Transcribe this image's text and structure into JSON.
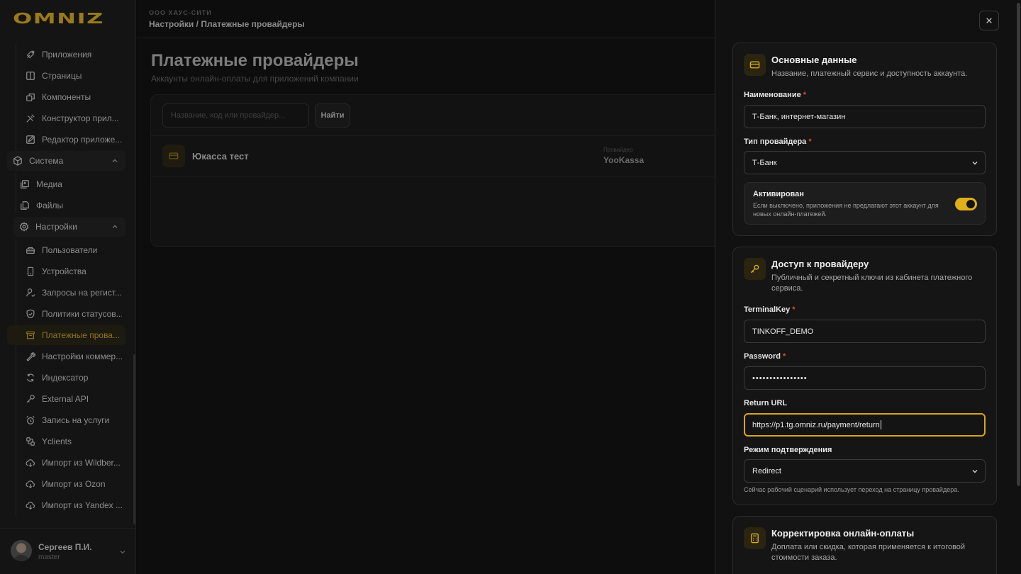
{
  "app": {
    "logo_text": "OMNIZ"
  },
  "sidebar": {
    "items": [
      {
        "label": "Приложения",
        "icon": "apps-icon"
      },
      {
        "label": "Страницы",
        "icon": "pages-icon"
      },
      {
        "label": "Компоненты",
        "icon": "components-icon"
      },
      {
        "label": "Конструктор прил...",
        "icon": "builder-icon"
      },
      {
        "label": "Редактор приложе...",
        "icon": "editor-icon"
      }
    ],
    "group_system": {
      "label": "Система",
      "icon": "system-icon"
    },
    "system_items": [
      {
        "label": "Медиа",
        "icon": "media-icon"
      },
      {
        "label": "Файлы",
        "icon": "files-icon"
      }
    ],
    "group_settings": {
      "label": "Настройки",
      "icon": "settings-icon"
    },
    "settings_items": [
      {
        "label": "Пользователи",
        "icon": "users-icon"
      },
      {
        "label": "Устройства",
        "icon": "device-icon"
      },
      {
        "label": "Запросы на регист...",
        "icon": "user-request-icon"
      },
      {
        "label": "Политики статусов...",
        "icon": "policy-icon"
      },
      {
        "label": "Платежные прова...",
        "icon": "payment-provider-icon",
        "active": true
      },
      {
        "label": "Настройки коммер...",
        "icon": "commerce-settings-icon"
      },
      {
        "label": "Индексатор",
        "icon": "refresh-icon"
      },
      {
        "label": "External API",
        "icon": "key-icon"
      },
      {
        "label": "Запись на услуги",
        "icon": "alarm-icon"
      },
      {
        "label": "Yclients",
        "icon": "yclients-icon"
      },
      {
        "label": "Импорт из Wildber...",
        "icon": "cloud-import-icon"
      },
      {
        "label": "Импорт из Ozon",
        "icon": "cloud-import-icon"
      },
      {
        "label": "Импорт из Yandex ...",
        "icon": "cloud-import-icon"
      }
    ],
    "user": {
      "name": "Сергеев П.И.",
      "role": "master"
    }
  },
  "main": {
    "company": "ООО ХАУС-СИТИ",
    "breadcrumb": "Настройки / Платежные провайдеры",
    "title": "Платежные провайдеры",
    "subtitle": "Аккаунты онлайн-оплаты для приложений компании",
    "search_placeholder": "Название, код или провайдер...",
    "find_label": "Найти",
    "rows": [
      {
        "name": "Юкасса тест",
        "provider_label": "Провайдер",
        "provider": "YooKassa"
      }
    ]
  },
  "drawer": {
    "basic": {
      "title": "Основные данные",
      "desc": "Название, платежный сервис и доступность аккаунта.",
      "name_label": "Наименование",
      "name_value": "Т-Банк, интернет-магазин",
      "type_label": "Тип провайдера",
      "type_value": "Т-Банк",
      "active_title": "Активирован",
      "active_desc": "Если выключено, приложения не предлагают этот аккаунт для новых онлайн-платежей.",
      "active_on": true
    },
    "access": {
      "title": "Доступ к провайдеру",
      "desc": "Публичный и секретный ключи из кабинета платежного сервиса.",
      "terminal_label": "TerminalKey",
      "terminal_value": "TINKOFF_DEMO",
      "password_label": "Password",
      "password_value": "••••••••••••••••",
      "return_label": "Return URL",
      "return_value": "https://p1.tg.omniz.ru/payment/return",
      "mode_label": "Режим подтверждения",
      "mode_value": "Redirect",
      "mode_hint": "Сейчас рабочий сценарий использует переход на страницу провайдера."
    },
    "adjust": {
      "title": "Корректировка онлайн-оплаты",
      "desc": "Доплата или скидка, которая применяется к итоговой стоимости заказа."
    },
    "required_mark": "*"
  },
  "colors": {
    "accent": "#e0b01c",
    "danger": "#e04a3a",
    "background": "#0b0b0b",
    "panel": "#151515"
  }
}
